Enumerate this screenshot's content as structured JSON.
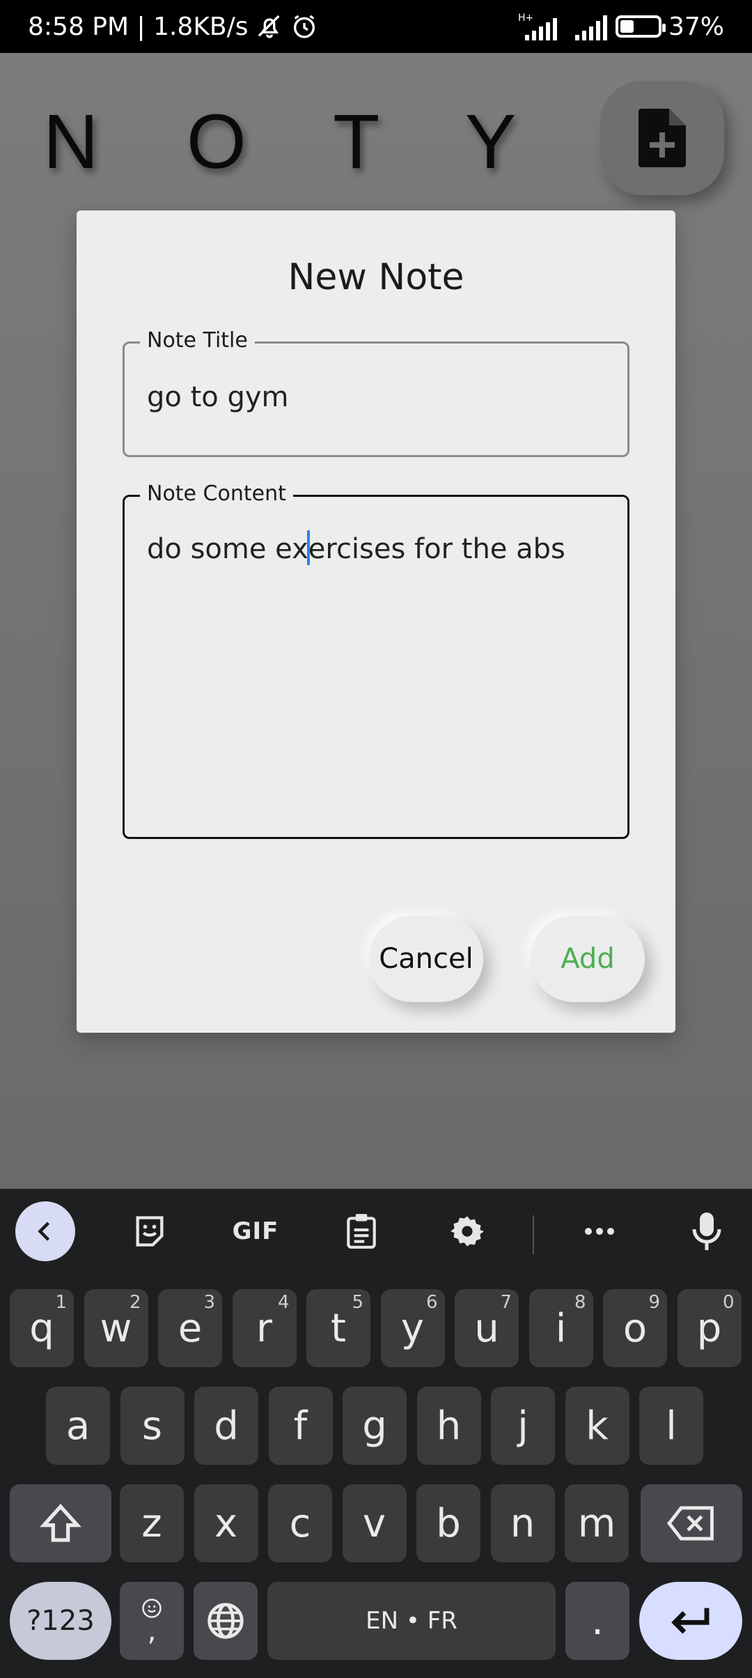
{
  "status_bar": {
    "time_speed": "8:58 PM | 1.8KB/s",
    "network_label": "H+",
    "battery_percent_label": "37%",
    "battery_level": 0.37
  },
  "app": {
    "title": "N O T Y"
  },
  "dialog": {
    "title": "New Note",
    "title_field": {
      "label": "Note Title",
      "value": "go to gym"
    },
    "content_field": {
      "label": "Note Content",
      "value_before_caret": "do some ex",
      "value_after_caret": "ercises for the abs"
    },
    "cancel_label": "Cancel",
    "add_label": "Add",
    "add_color": "#4caf50"
  },
  "keyboard": {
    "toolbar": {
      "gif_label": "GIF"
    },
    "row1": [
      {
        "key": "q",
        "hint": "1"
      },
      {
        "key": "w",
        "hint": "2"
      },
      {
        "key": "e",
        "hint": "3"
      },
      {
        "key": "r",
        "hint": "4"
      },
      {
        "key": "t",
        "hint": "5"
      },
      {
        "key": "y",
        "hint": "6"
      },
      {
        "key": "u",
        "hint": "7"
      },
      {
        "key": "i",
        "hint": "8"
      },
      {
        "key": "o",
        "hint": "9"
      },
      {
        "key": "p",
        "hint": "0"
      }
    ],
    "row2": [
      "a",
      "s",
      "d",
      "f",
      "g",
      "h",
      "j",
      "k",
      "l"
    ],
    "row3": [
      "z",
      "x",
      "c",
      "v",
      "b",
      "n",
      "m"
    ],
    "symbols_label": "?123",
    "comma_label": ",",
    "space_label": "EN • FR",
    "period_label": "."
  }
}
